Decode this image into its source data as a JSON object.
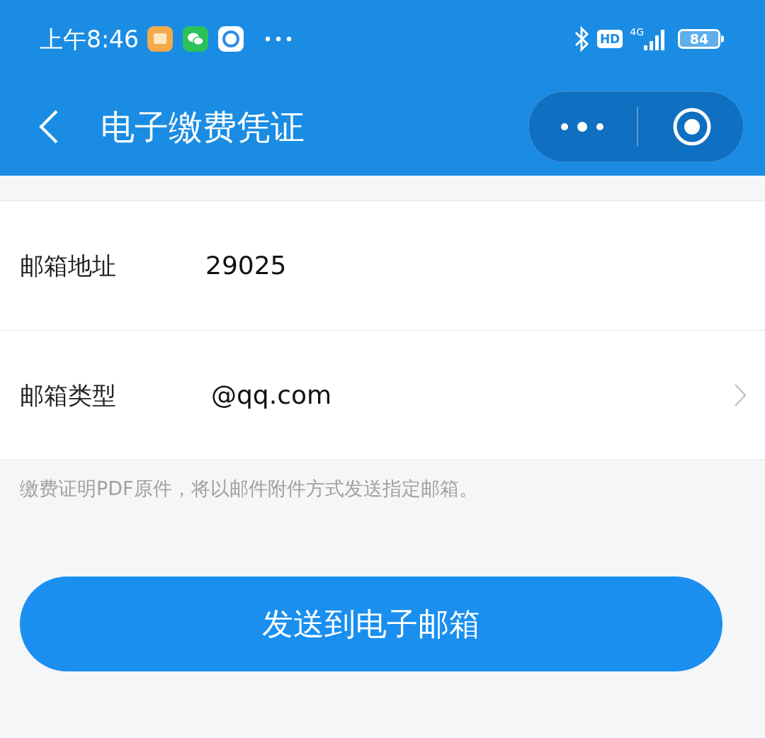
{
  "status_bar": {
    "time": "上午8:46",
    "hd": "HD",
    "network": "4G",
    "battery": "84"
  },
  "nav": {
    "title": "电子缴费凭证"
  },
  "form": [
    {
      "kind": "input",
      "label": "邮箱地址",
      "value": "29025"
    },
    {
      "kind": "select",
      "label": "邮箱类型",
      "value": "@qq.com"
    }
  ],
  "hint": "缴费证明PDF原件，将以邮件附件方式发送指定邮箱。",
  "button": "发送到电子邮箱"
}
